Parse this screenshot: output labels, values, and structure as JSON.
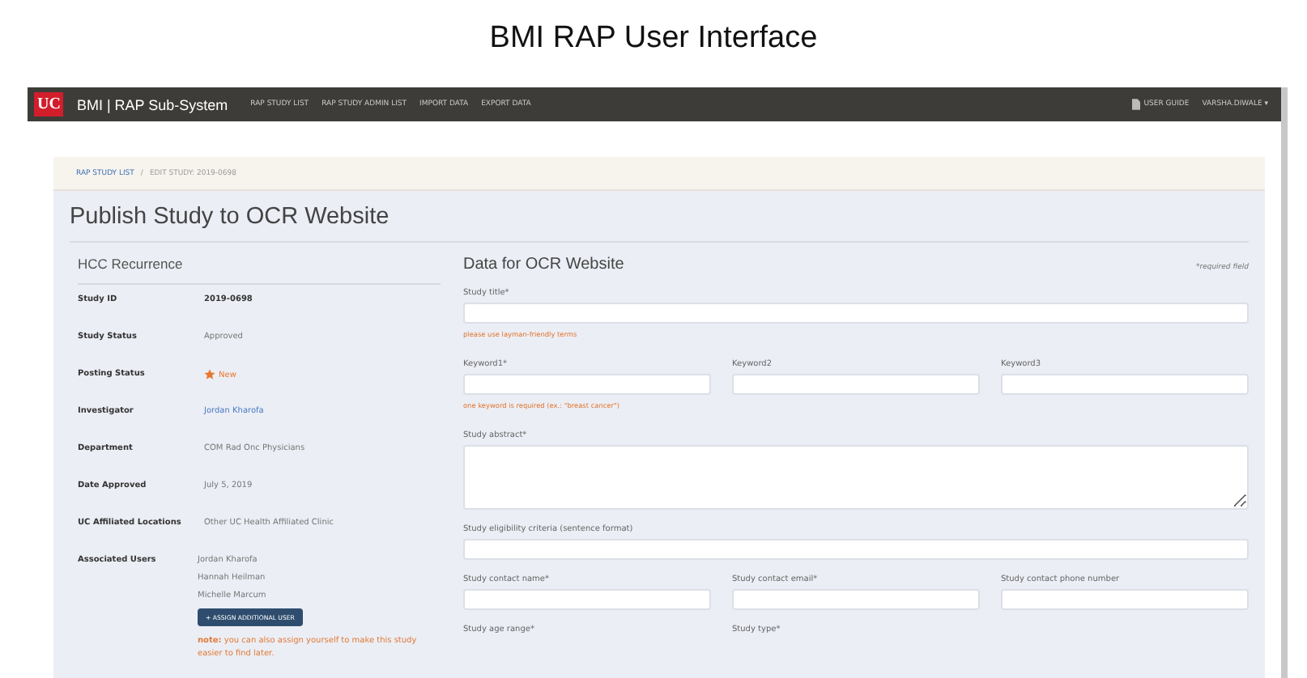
{
  "slide_title": "BMI RAP User Interface",
  "navbar": {
    "logo": "UC",
    "brand": "BMI | RAP Sub-System",
    "links": [
      "RAP STUDY LIST",
      "RAP STUDY ADMIN LIST",
      "IMPORT DATA",
      "EXPORT DATA"
    ],
    "user_guide": "USER GUIDE",
    "user": "VARSHA.DIWALE",
    "caret": "▾"
  },
  "breadcrumb": [
    {
      "label": "RAP STUDY LIST",
      "link": true
    },
    {
      "label": "/",
      "link": false
    },
    {
      "label": "EDIT STUDY: 2019-0698",
      "link": false
    }
  ],
  "page_title": "Publish Study to OCR Website",
  "study": {
    "title": "HCC Recurrence",
    "fields": [
      {
        "label": "Study ID",
        "kind": "bold",
        "values": [
          "2019-0698"
        ]
      },
      {
        "label": "Study Status",
        "kind": "plain",
        "values": [
          "Approved"
        ]
      },
      {
        "label": "Posting Status",
        "kind": "status",
        "values": [
          "New"
        ]
      },
      {
        "label": "Investigator",
        "kind": "link",
        "values": [
          "Jordan Kharofa"
        ]
      },
      {
        "label": "Department",
        "kind": "plain",
        "values": [
          "COM Rad Onc Physicians"
        ]
      },
      {
        "label": "Date Approved",
        "kind": "plain",
        "values": [
          "July 5, 2019"
        ]
      },
      {
        "label": "UC Affiliated Locations",
        "kind": "plain",
        "values": [
          "Other UC Health Affiliated Clinic"
        ]
      },
      {
        "label": "Associated Users",
        "kind": "plain",
        "values": [
          "Jordan Kharofa",
          "Hannah Heilman",
          "Michelle Marcum"
        ]
      }
    ],
    "assign_button": "+ ASSIGN ADDITIONAL USER",
    "note": "**note:** you can also assign yourself to make this study easier to find later."
  },
  "form": {
    "title": "Data for OCR Website",
    "required_note": "*required field",
    "rows": [
      [
        {
          "label": "Study title*",
          "kind": "input",
          "hint": "please use layman-friendly terms"
        }
      ],
      [
        {
          "label": "Keyword1*",
          "kind": "input",
          "hint": "one keyword is required (ex.: \"breast cancer\")"
        },
        {
          "label": "Keyword2",
          "kind": "input"
        },
        {
          "label": "Keyword3",
          "kind": "input"
        }
      ],
      [
        {
          "label": "Study abstract*",
          "kind": "textarea"
        }
      ],
      [
        {
          "label": "Study eligibility criteria (sentence format)",
          "kind": "input"
        }
      ],
      [
        {
          "label": "Study contact name*",
          "kind": "input"
        },
        {
          "label": "Study contact email*",
          "kind": "input"
        },
        {
          "label": "Study contact phone number",
          "kind": "input"
        }
      ],
      [
        {
          "label": "Study age range*",
          "kind": "label"
        },
        {
          "label": "Study type*",
          "kind": "label"
        },
        {
          "kind": "blank"
        }
      ]
    ]
  }
}
